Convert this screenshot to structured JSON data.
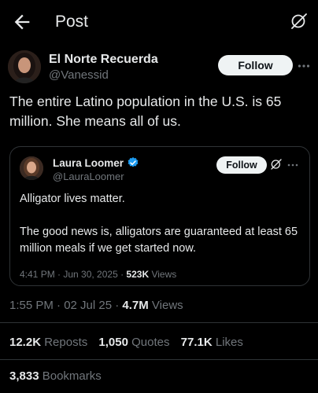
{
  "header": {
    "title": "Post"
  },
  "author": {
    "name": "El Norte Recuerda",
    "handle": "@Vanessid",
    "follow_label": "Follow"
  },
  "post": {
    "text": "The entire Latino population in the U.S. is 65 million. She means all of us.",
    "timestamp": "1:55 PM · 02 Jul 25 · ",
    "views_count": "4.7M",
    "views_label": " Views",
    "reposts_count": "12.2K",
    "reposts_label": "Reposts",
    "quotes_count": "1,050",
    "quotes_label": "Quotes",
    "likes_count": "77.1K",
    "likes_label": "Likes",
    "bookmarks_count": "3,833",
    "bookmarks_label": "Bookmarks"
  },
  "quote": {
    "name": "Laura Loomer",
    "handle": "@LauraLoomer",
    "follow_label": "Follow",
    "line1": "Alligator lives matter.",
    "line2": "The good news is, alligators are guaranteed at least 65 million meals if we get started now.",
    "timestamp": "4:41 PM · Jun 30, 2025 · ",
    "views_count": "523K",
    "views_label": " Views"
  },
  "colors": {
    "background": "#000000",
    "text": "#e7e9ea",
    "muted": "#71767b",
    "verified": "#1d9bf0",
    "button": "#eff3f4"
  }
}
